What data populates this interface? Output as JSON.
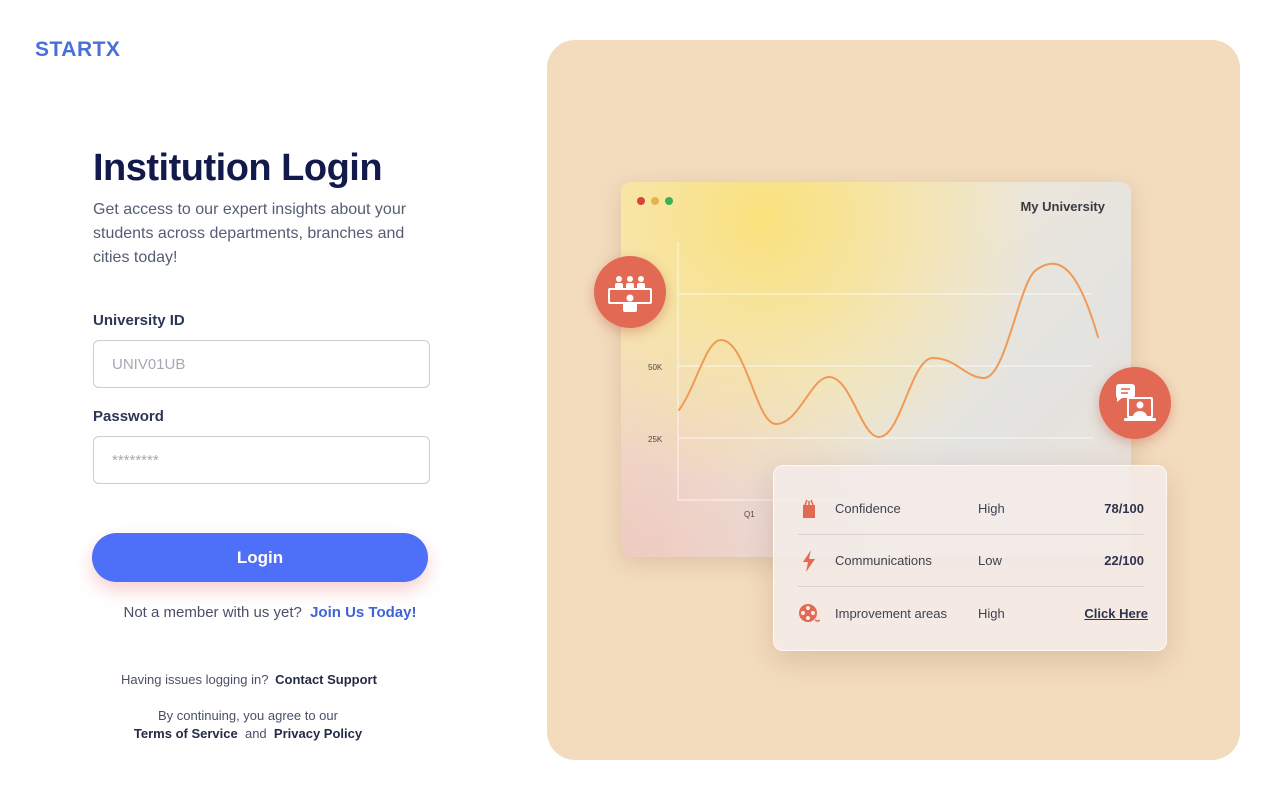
{
  "brand": {
    "logo": "STARTX"
  },
  "login": {
    "title": "Institution Login",
    "subtitle": "Get access to our expert insights about your students across departments, branches and cities today!",
    "university_id_label": "University ID",
    "university_id_placeholder": "UNIV01UB",
    "password_label": "Password",
    "password_placeholder": "********",
    "login_button": "Login",
    "join_prompt": "Not a member with us yet?",
    "join_link": "Join Us Today!",
    "help_prompt": "Having issues logging in?",
    "help_link": "Contact Support",
    "legal_prompt": "By continuing, you agree to our",
    "terms_link": "Terms of Service",
    "legal_and": "and",
    "privacy_link": "Privacy Policy"
  },
  "illustration": {
    "card_title": "My University",
    "window_dots": [
      "#d8443a",
      "#e6b24a",
      "#3fae5a"
    ],
    "accent": "#e26a54",
    "chart_data": {
      "type": "line",
      "y_ticks": [
        "50K",
        "25K"
      ],
      "x_ticks": [
        "Q1"
      ]
    },
    "stats": [
      {
        "name": "Confidence",
        "level": "High",
        "score": "78/100",
        "icon": "gift-bag-icon"
      },
      {
        "name": "Communications",
        "level": "Low",
        "score": "22/100",
        "icon": "lightning-icon"
      },
      {
        "name": "Improvement areas",
        "level": "High",
        "link": "Click Here",
        "icon": "film-reel-icon"
      }
    ]
  }
}
